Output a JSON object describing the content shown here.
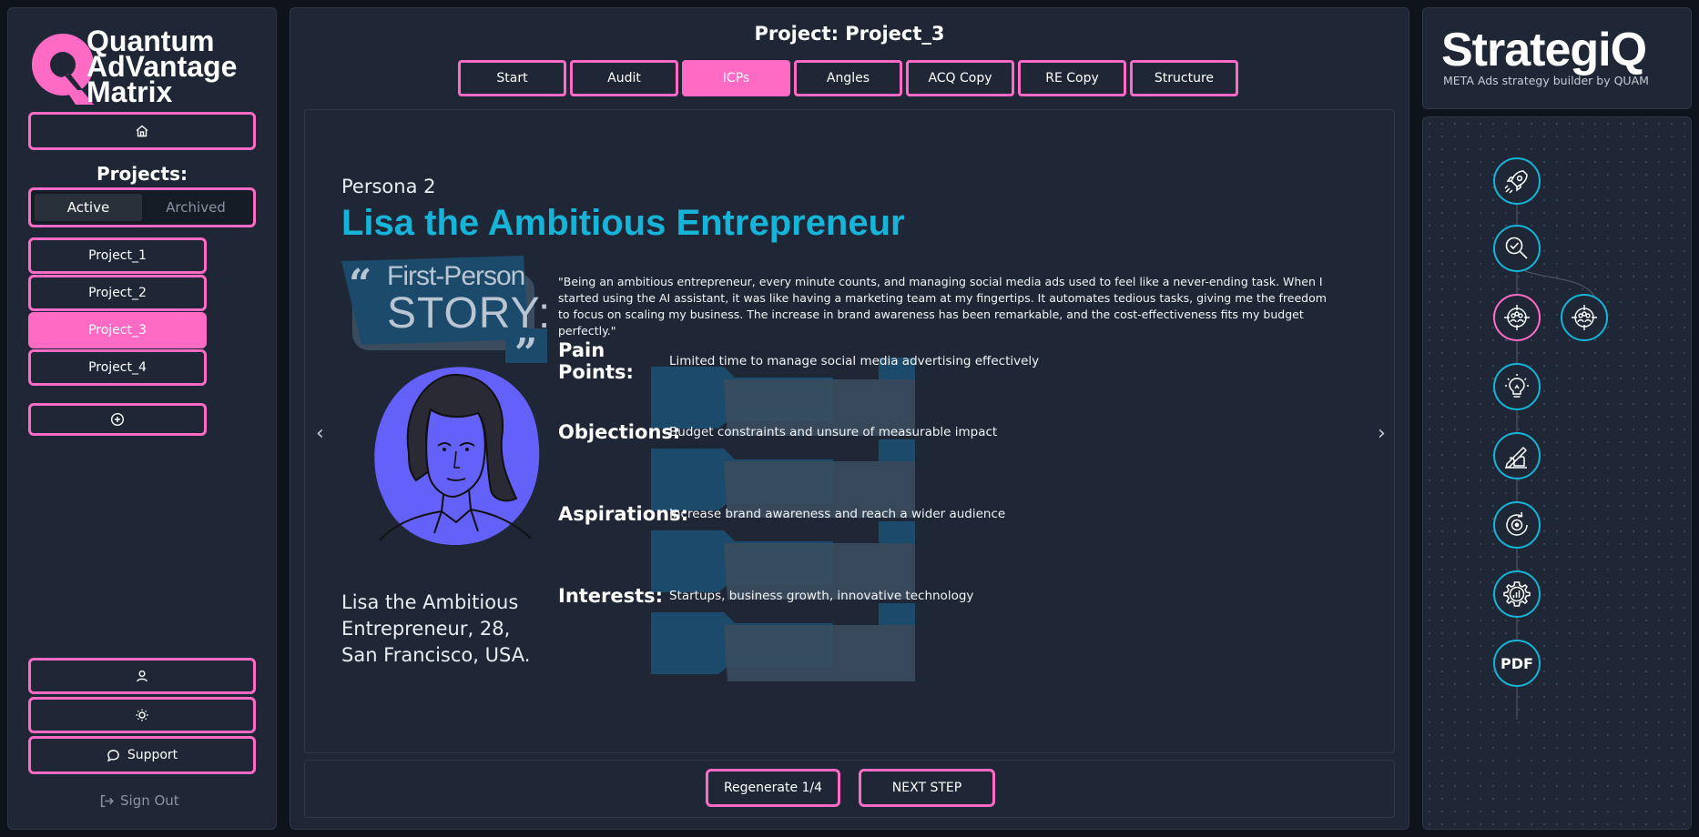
{
  "colors": {
    "accent_pink": "#ff6bc4",
    "accent_cyan": "#15b4d8",
    "avatar_blue": "#6461fb",
    "panel": "#1f2736",
    "background": "#0f141c"
  },
  "sidebar": {
    "logo_lines": [
      "Quantum",
      "AdVantage",
      "Matrix"
    ],
    "home_icon": "home-icon",
    "projects_title": "Projects:",
    "toggle": {
      "active": "Active",
      "archived": "Archived"
    },
    "projects": [
      "Project_1",
      "Project_2",
      "Project_3",
      "Project_4"
    ],
    "selected_project": "Project_3",
    "add_icon": "plus-circle-icon",
    "user_icon": "user-icon",
    "theme_icon": "sun-icon",
    "support_label": "Support",
    "signout_label": "Sign Out"
  },
  "header": {
    "project_title": "Project: Project_3",
    "tabs": [
      "Start",
      "Audit",
      "ICPs",
      "Angles",
      "ACQ Copy",
      "RE Copy",
      "Structure"
    ],
    "active_tab": "ICPs"
  },
  "persona": {
    "label": "Persona 2",
    "name": "Lisa the Ambitious Entrepreneur",
    "badge": {
      "line1": "First-Person",
      "line2": "STORY:"
    },
    "description": "Lisa the Ambitious Entrepreneur, 28, San Francisco, USA.",
    "quote": "\"Being an ambitious entrepreneur, every minute counts, and managing social media ads used to feel like a never-ending task. When I started using the AI assistant, it was like having a marketing team at my fingertips. It automates tedious tasks, giving me the freedom to focus on scaling my business. The increase in brand awareness has been remarkable, and the cost-effectiveness fits my budget perfectly.\"",
    "traits": [
      {
        "label": "Pain Points:",
        "value": "Limited time to manage social media advertising effectively"
      },
      {
        "label": "Objections:",
        "value": "Budget constraints and unsure of measurable impact"
      },
      {
        "label": "Aspirations:",
        "value": "Increase brand awareness and reach a wider audience"
      },
      {
        "label": "Interests:",
        "value": "Startups, business growth, innovative technology"
      }
    ]
  },
  "footer": {
    "regenerate_label": "Regenerate 1/4",
    "next_label": "NEXT STEP"
  },
  "brand": {
    "name": "StrategiQ",
    "subtitle": "META Ads strategy builder by QUAM"
  },
  "workflow": {
    "nodes": [
      "rocket-icon",
      "magnify-check-icon",
      "target-people-icon",
      "target-people-icon",
      "lightbulb-icon",
      "hand-writing-icon",
      "target-cycle-icon",
      "gear-chart-icon",
      "pdf-icon"
    ],
    "pdf_label": "PDF"
  }
}
